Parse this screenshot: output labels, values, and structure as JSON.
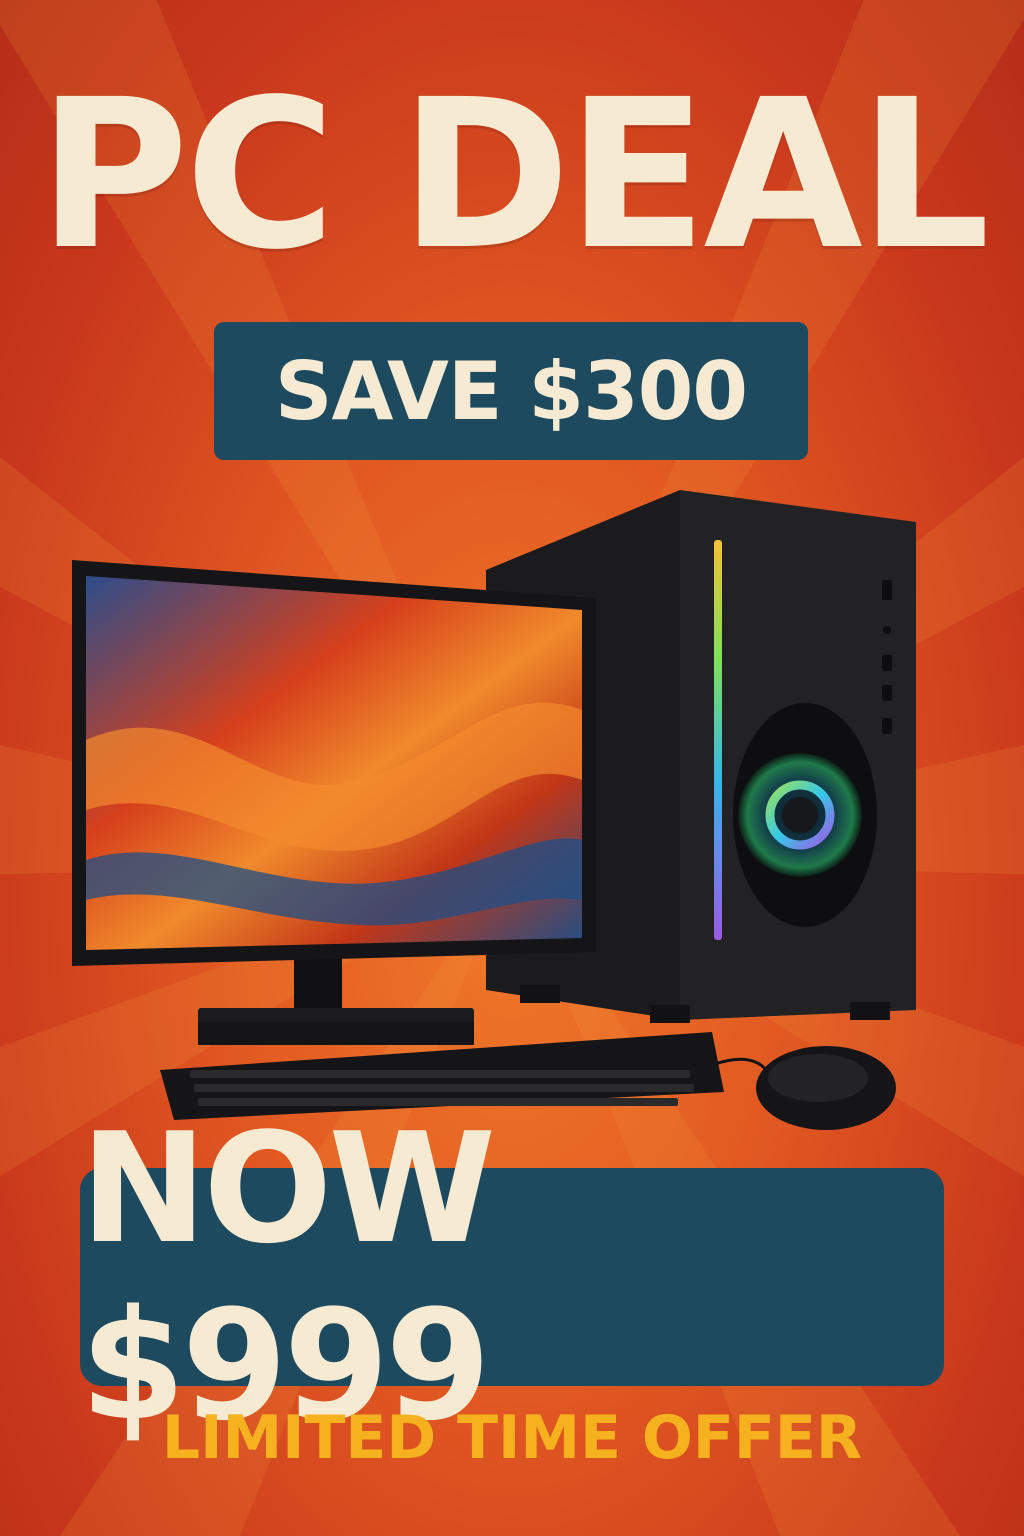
{
  "headline": "PC DEAL",
  "save_badge": {
    "text": "SAVE $300"
  },
  "price_badge": {
    "text": "NOW $999"
  },
  "tagline": "LIMITED TIME OFFER",
  "colors": {
    "background": "#d9481f",
    "badge": "#1d4a5e",
    "headline_text": "#f6ead2",
    "tagline_text": "#f5b21e"
  },
  "icons": [
    "monitor-icon",
    "pc-tower-icon",
    "keyboard-icon",
    "mouse-icon"
  ]
}
